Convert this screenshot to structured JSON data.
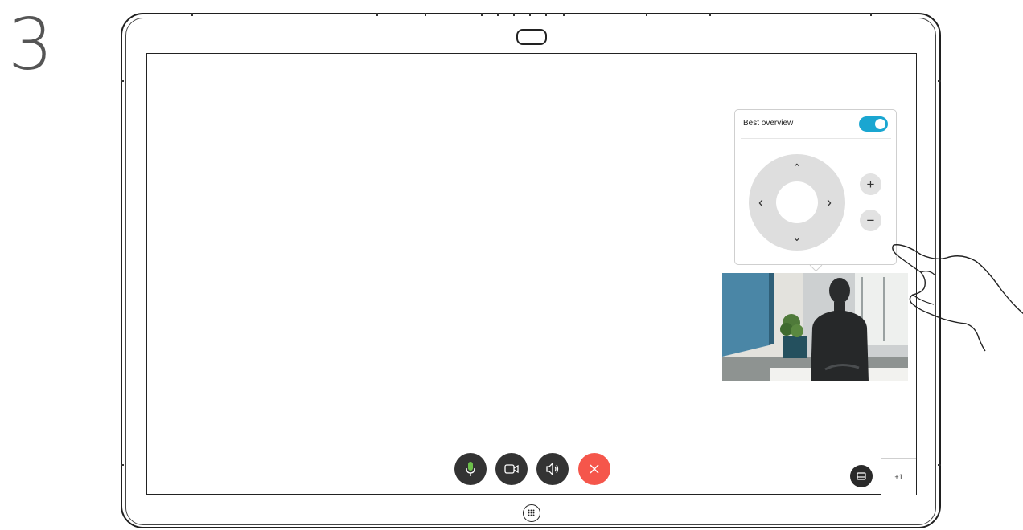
{
  "step": {
    "number": "3"
  },
  "camera_panel": {
    "title": "Best overview",
    "toggle_on": true,
    "zoom_in_label": "+",
    "zoom_out_label": "−",
    "arrows": {
      "up": "⌃",
      "down": "⌄",
      "left": "‹",
      "right": "›"
    }
  },
  "participants": {
    "label": "+1"
  },
  "colors": {
    "toggle_accent": "#1aa6d1",
    "end_call": "#f5564b",
    "mic_active": "#6cc04a",
    "control_dark": "#333333"
  },
  "icons": {
    "mic": "microphone-icon",
    "camera": "video-camera-icon",
    "speaker": "speaker-icon",
    "end_call": "close-icon",
    "layout": "layout-icon",
    "home": "home-grid-icon"
  }
}
